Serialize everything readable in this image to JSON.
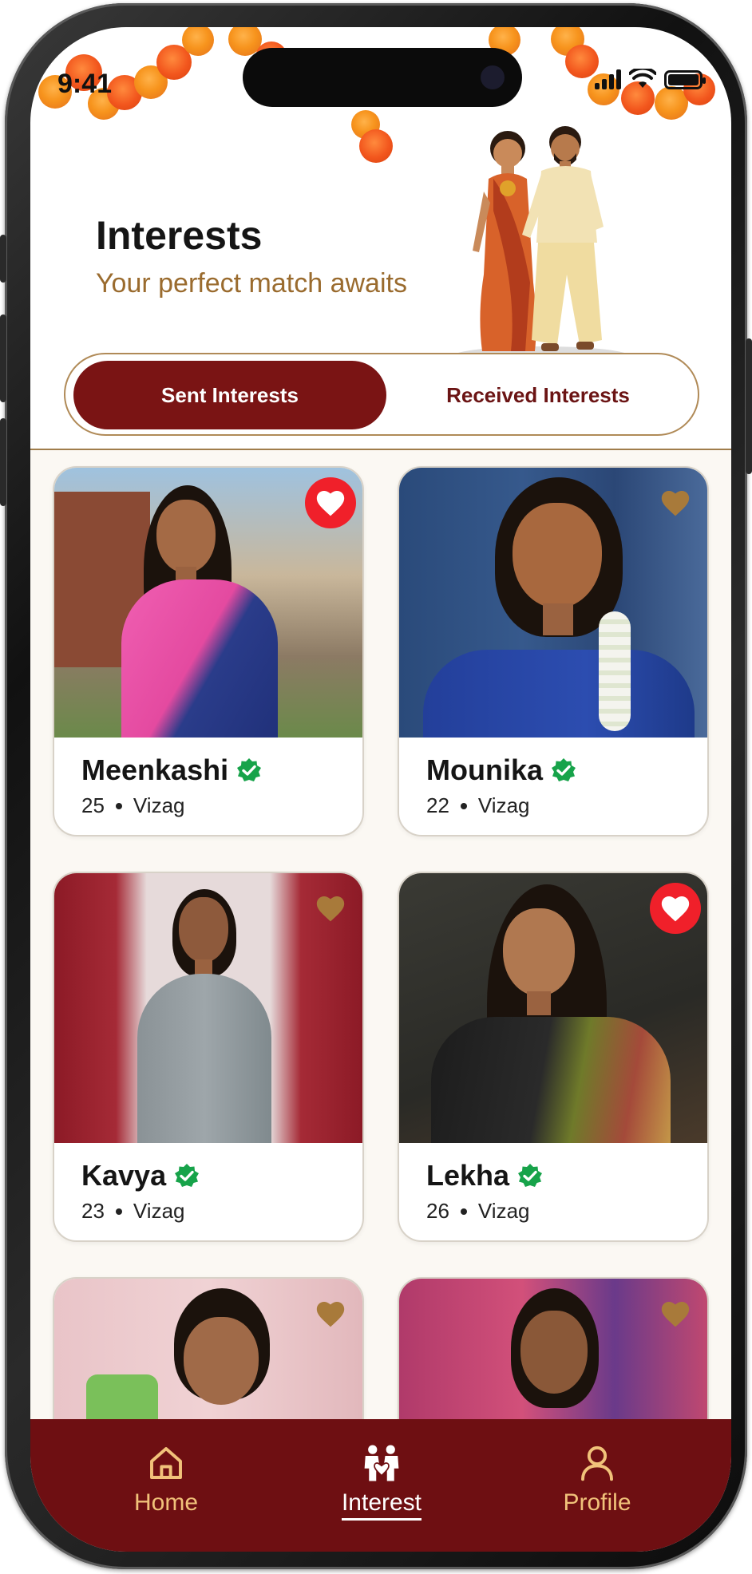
{
  "status_bar": {
    "time": "9:41"
  },
  "header": {
    "title": "Interests",
    "subtitle": "Your perfect match awaits"
  },
  "tabs": {
    "sent": "Sent Interests",
    "received": "Received Interests",
    "active": "sent"
  },
  "profiles": [
    {
      "name": "Meenkashi",
      "age": "25",
      "city": "Vizag",
      "verified": true,
      "favorited": true
    },
    {
      "name": "Mounika",
      "age": "22",
      "city": "Vizag",
      "verified": true,
      "favorited": false
    },
    {
      "name": "Kavya",
      "age": "23",
      "city": "Vizag",
      "verified": true,
      "favorited": false
    },
    {
      "name": "Lekha",
      "age": "26",
      "city": "Vizag",
      "verified": true,
      "favorited": true
    },
    {
      "name": "",
      "age": "",
      "city": "",
      "verified": false,
      "favorited": false
    },
    {
      "name": "",
      "age": "",
      "city": "",
      "verified": false,
      "favorited": false
    }
  ],
  "nav": {
    "items": [
      {
        "label": "Home",
        "icon": "home-icon"
      },
      {
        "label": "Interest",
        "icon": "couple-heart-icon"
      },
      {
        "label": "Profile",
        "icon": "user-icon"
      }
    ],
    "active": "Interest"
  },
  "colors": {
    "primary": "#7a1414",
    "accent": "#9a6b2e",
    "nav_label": "#f1c27a",
    "favorite_on": "#f0202a",
    "favorite_off": "#a87a3a",
    "verified": "#17a34a"
  }
}
